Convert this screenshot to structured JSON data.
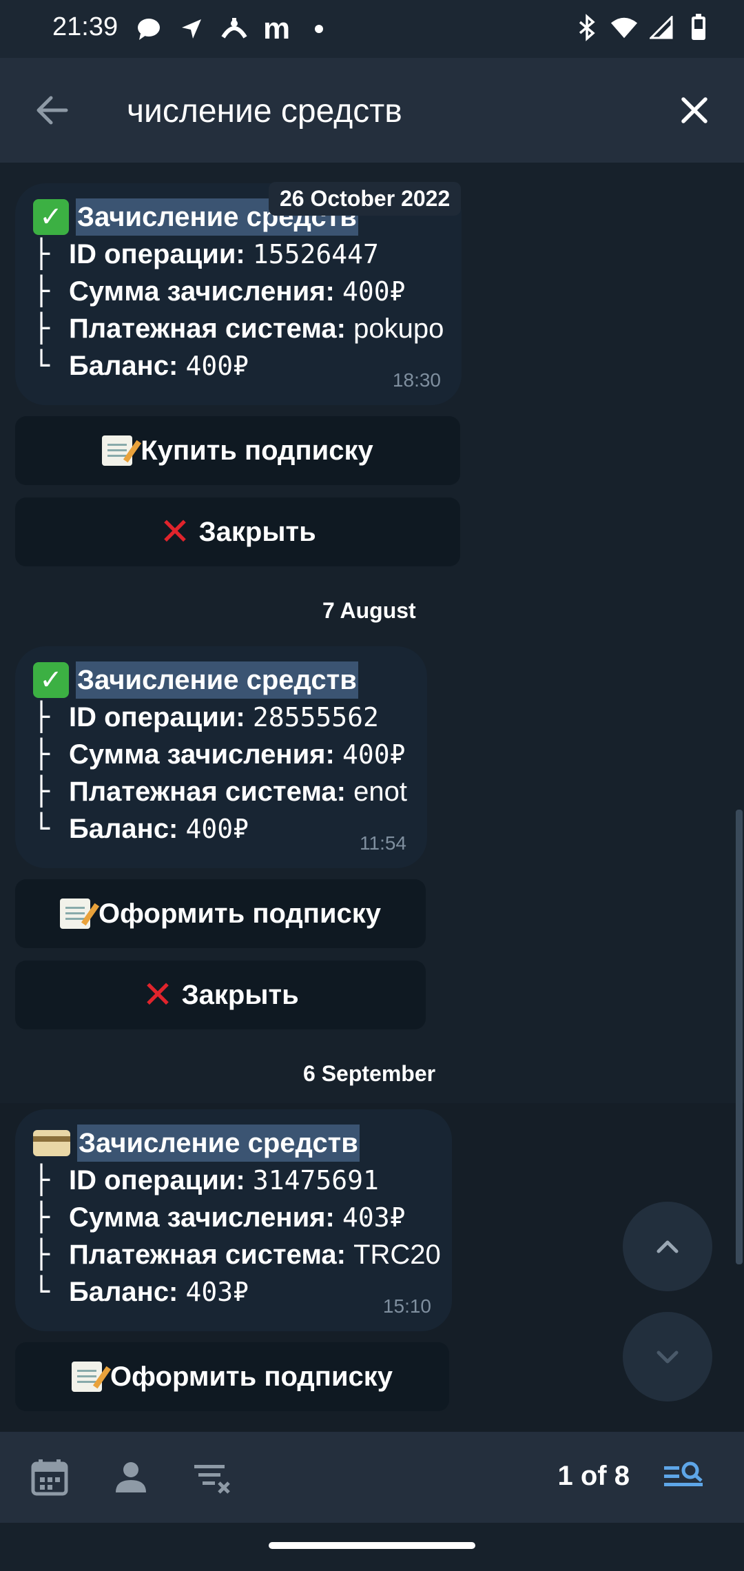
{
  "status": {
    "time": "21:39",
    "left_icons": [
      "chat-bubble-icon",
      "location-arrow-icon",
      "cross-app-icon",
      "m-app-icon",
      "dot-icon"
    ],
    "m_label": "m",
    "right_icons": [
      "bluetooth-icon",
      "wifi-icon",
      "signal-icon",
      "battery-icon"
    ]
  },
  "search": {
    "query": "числение средств"
  },
  "messages": [
    {
      "date": "26 October 2022",
      "icon": "check-mark-emoji",
      "title": "Зачисление средств",
      "rows": [
        {
          "tree": "├",
          "label": "ID операции:",
          "value": "15526447"
        },
        {
          "tree": "├",
          "label": "Сумма зачисления:",
          "value": "400₽"
        },
        {
          "tree": "├",
          "label": "Платежная система:",
          "value": "pokupo"
        },
        {
          "tree": "└",
          "label": "Баланс:",
          "value": "400₽"
        }
      ],
      "time": "18:30",
      "buttons": [
        "Купить подписку",
        "Закрыть"
      ]
    },
    {
      "date": "7 August",
      "icon": "check-mark-emoji",
      "title": "Зачисление средств",
      "rows": [
        {
          "tree": "├",
          "label": "ID операции:",
          "value": "28555562"
        },
        {
          "tree": "├",
          "label": "Сумма зачисления:",
          "value": "400₽"
        },
        {
          "tree": "├",
          "label": "Платежная система:",
          "value": "enot"
        },
        {
          "tree": "└",
          "label": "Баланс:",
          "value": "400₽"
        }
      ],
      "time": "11:54",
      "buttons": [
        "Оформить подписку",
        "Закрыть"
      ]
    },
    {
      "date": "6 September",
      "icon": "credit-card-emoji",
      "title": "Зачисление средств",
      "rows": [
        {
          "tree": "├",
          "label": "ID операции:",
          "value": "31475691"
        },
        {
          "tree": "├",
          "label": "Сумма зачисления:",
          "value": "403₽"
        },
        {
          "tree": "├",
          "label": "Платежная система:",
          "value": "TRC20"
        },
        {
          "tree": "└",
          "label": "Баланс:",
          "value": "403₽"
        }
      ],
      "time": "15:10",
      "buttons": [
        "Оформить подписку"
      ]
    }
  ],
  "search_results": {
    "counter": "1 of 8"
  },
  "colors": {
    "background": "#17212b",
    "header": "#242f3d",
    "bubble": "#182533",
    "highlight": "#3b5472",
    "accent": "#5ea6e8"
  }
}
